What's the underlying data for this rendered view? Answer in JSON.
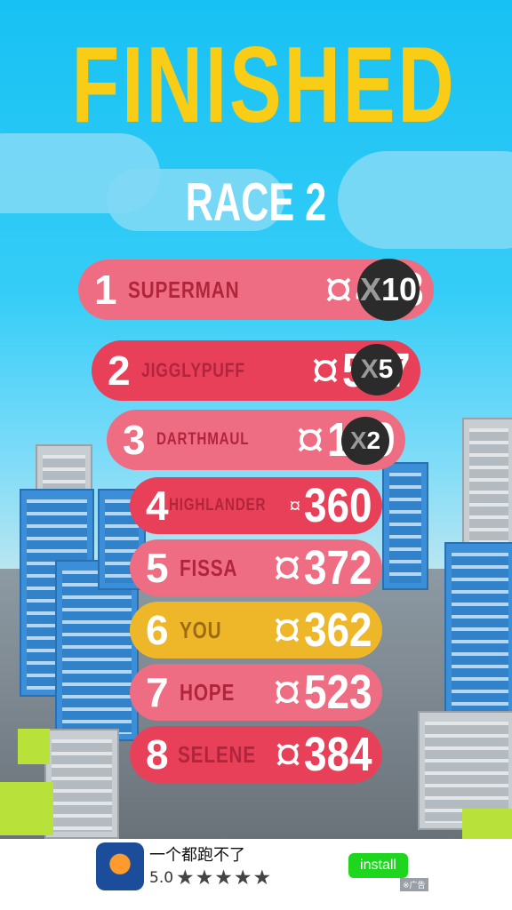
{
  "title": "FINISHED",
  "subtitle": "RACE 2",
  "leaderboard": [
    {
      "rank": "1",
      "name": "SUPERMAN",
      "score": "458",
      "multiplier": "10",
      "row_color": "#ef6d82"
    },
    {
      "rank": "2",
      "name": "JIGGLYPUFF",
      "score": "537",
      "multiplier": "5",
      "row_color": "#e9405a"
    },
    {
      "rank": "3",
      "name": "DARTHMAUL",
      "score": "199",
      "multiplier": "2",
      "row_color": "#ef6d82"
    },
    {
      "rank": "4",
      "name": "HIGHLANDER",
      "score": "360",
      "multiplier": null,
      "row_color": "#e9405a"
    },
    {
      "rank": "5",
      "name": "FISSA",
      "score": "372",
      "multiplier": null,
      "row_color": "#ef6d82"
    },
    {
      "rank": "6",
      "name": "YOU",
      "score": "362",
      "multiplier": null,
      "row_color": "#eeb72a"
    },
    {
      "rank": "7",
      "name": "HOPE",
      "score": "523",
      "multiplier": null,
      "row_color": "#ef6d82"
    },
    {
      "rank": "8",
      "name": "SELENE",
      "score": "384",
      "multiplier": null,
      "row_color": "#e9405a"
    }
  ],
  "multiplier_prefix": "X",
  "coin_icon": "coin-icon",
  "ad": {
    "app_name": "一个都跑不了",
    "rating": "5.0",
    "stars": "★★★★★",
    "install_label": "install",
    "ad_tag": "※广告"
  },
  "colors": {
    "title": "#f9cc16",
    "name_text": "#b1253c",
    "multiplier_bg": "#2b2b2b",
    "install": "#1ed61e"
  }
}
